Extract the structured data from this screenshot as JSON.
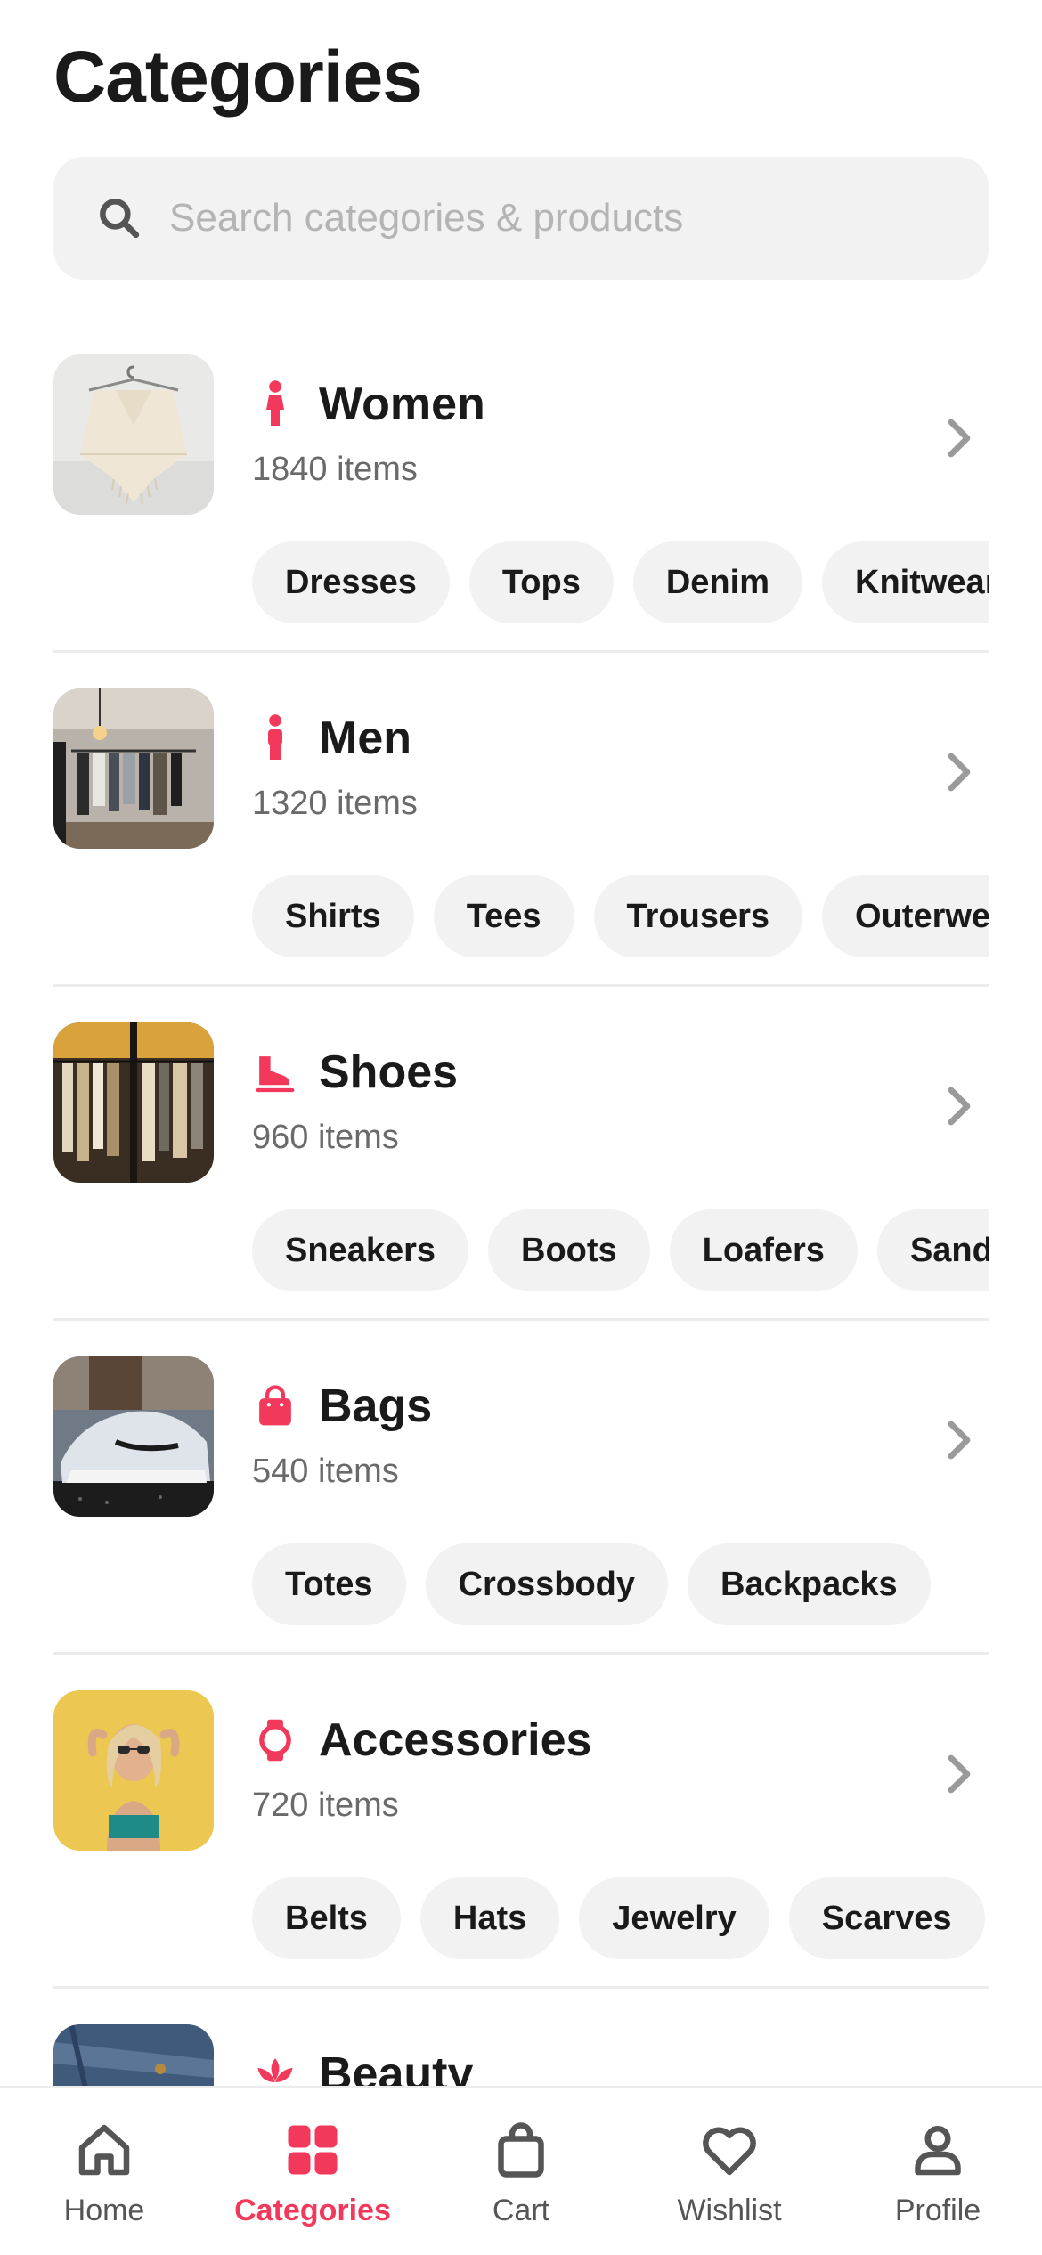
{
  "header": {
    "title": "Categories"
  },
  "search": {
    "placeholder": "Search categories & products"
  },
  "colors": {
    "accent": "#f2395b",
    "chip_bg": "#f2f2f2",
    "text": "#1a1a1a",
    "muted": "#6a6a6a"
  },
  "categories": [
    {
      "name": "Women",
      "count": "1840 items",
      "icon": "woman-icon",
      "image": "cream-poncho-on-hanger",
      "chips": [
        "Dresses",
        "Tops",
        "Denim",
        "Knitwear"
      ]
    },
    {
      "name": "Men",
      "count": "1320 items",
      "icon": "man-icon",
      "image": "clothing-store-rack",
      "chips": [
        "Shirts",
        "Tees",
        "Trousers",
        "Outerwear"
      ]
    },
    {
      "name": "Shoes",
      "count": "960 items",
      "icon": "skate-shoe-icon",
      "image": "boutique-window-rack",
      "chips": [
        "Sneakers",
        "Boots",
        "Loafers",
        "Sandals"
      ]
    },
    {
      "name": "Bags",
      "count": "540 items",
      "icon": "shopping-bag-icon",
      "image": "white-sneaker",
      "chips": [
        "Totes",
        "Crossbody",
        "Backpacks"
      ]
    },
    {
      "name": "Accessories",
      "count": "720 items",
      "icon": "watch-icon",
      "image": "woman-with-sunglasses",
      "chips": [
        "Belts",
        "Hats",
        "Jewelry",
        "Scarves"
      ]
    },
    {
      "name": "Beauty",
      "count": "",
      "icon": "lotus-icon",
      "image": "denim-jacket",
      "chips": []
    }
  ],
  "tabbar": [
    {
      "label": "Home",
      "icon": "home-icon",
      "active": false
    },
    {
      "label": "Categories",
      "icon": "grid-icon",
      "active": true
    },
    {
      "label": "Cart",
      "icon": "bag-icon",
      "active": false
    },
    {
      "label": "Wishlist",
      "icon": "heart-icon",
      "active": false
    },
    {
      "label": "Profile",
      "icon": "person-icon",
      "active": false
    }
  ]
}
